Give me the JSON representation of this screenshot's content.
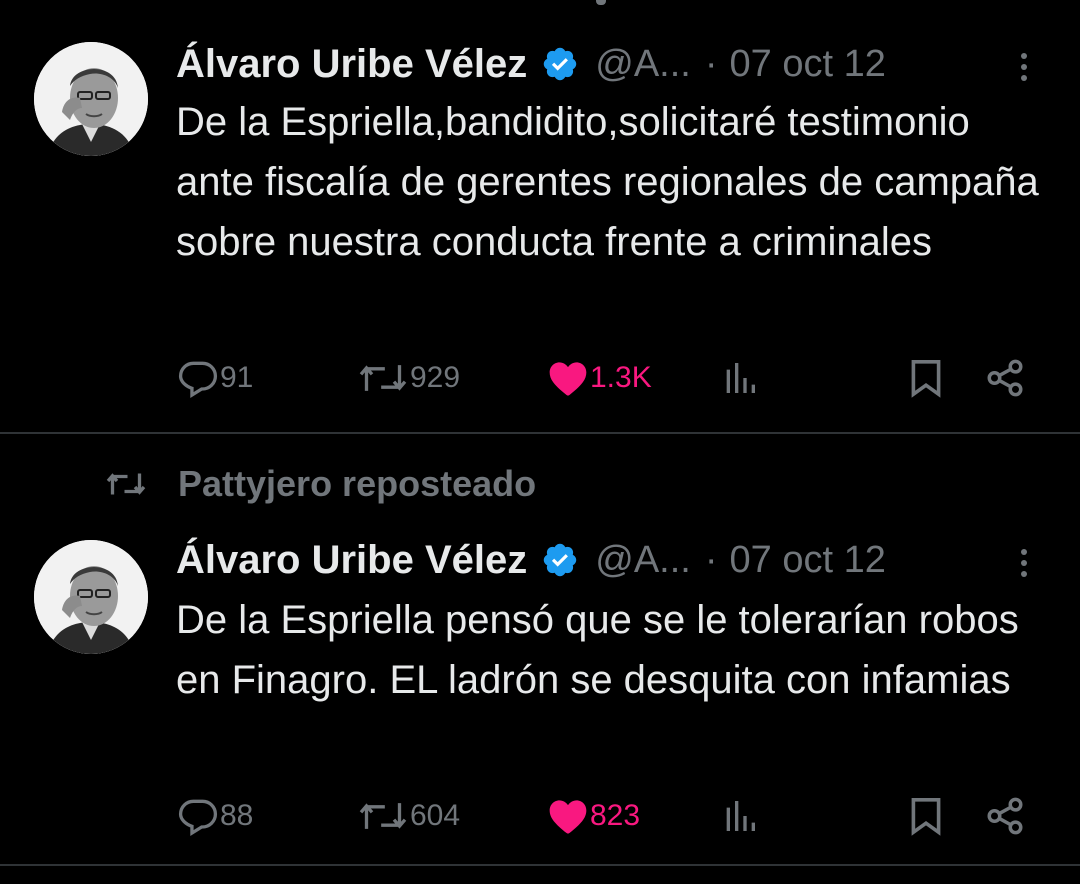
{
  "tweets": [
    {
      "name": "Álvaro Uribe Vélez",
      "handle": "@A...",
      "separator": "·",
      "date": "07 oct 12",
      "text": "De la Espriella,bandidito,solicitaré testimonio ante fiscalía de gerentes regionales de campaña sobre nuestra conducta frente a criminales",
      "replies": "91",
      "reposts": "929",
      "likes": "1.3K"
    },
    {
      "name": "Álvaro Uribe Vélez",
      "handle": "@A...",
      "separator": "·",
      "date": "07 oct 12",
      "text": "De la Espriella pensó que se le tolerarían robos en Finagro. EL ladrón se desquita con infamias",
      "replies": "88",
      "reposts": "604",
      "likes": "823"
    }
  ],
  "repost_banner": {
    "text": "Pattyjero reposteado"
  },
  "colors": {
    "background": "#000000",
    "muted": "#71767b",
    "like": "#f91880",
    "verified": "#1d9bf0",
    "divider": "#2f3336"
  }
}
